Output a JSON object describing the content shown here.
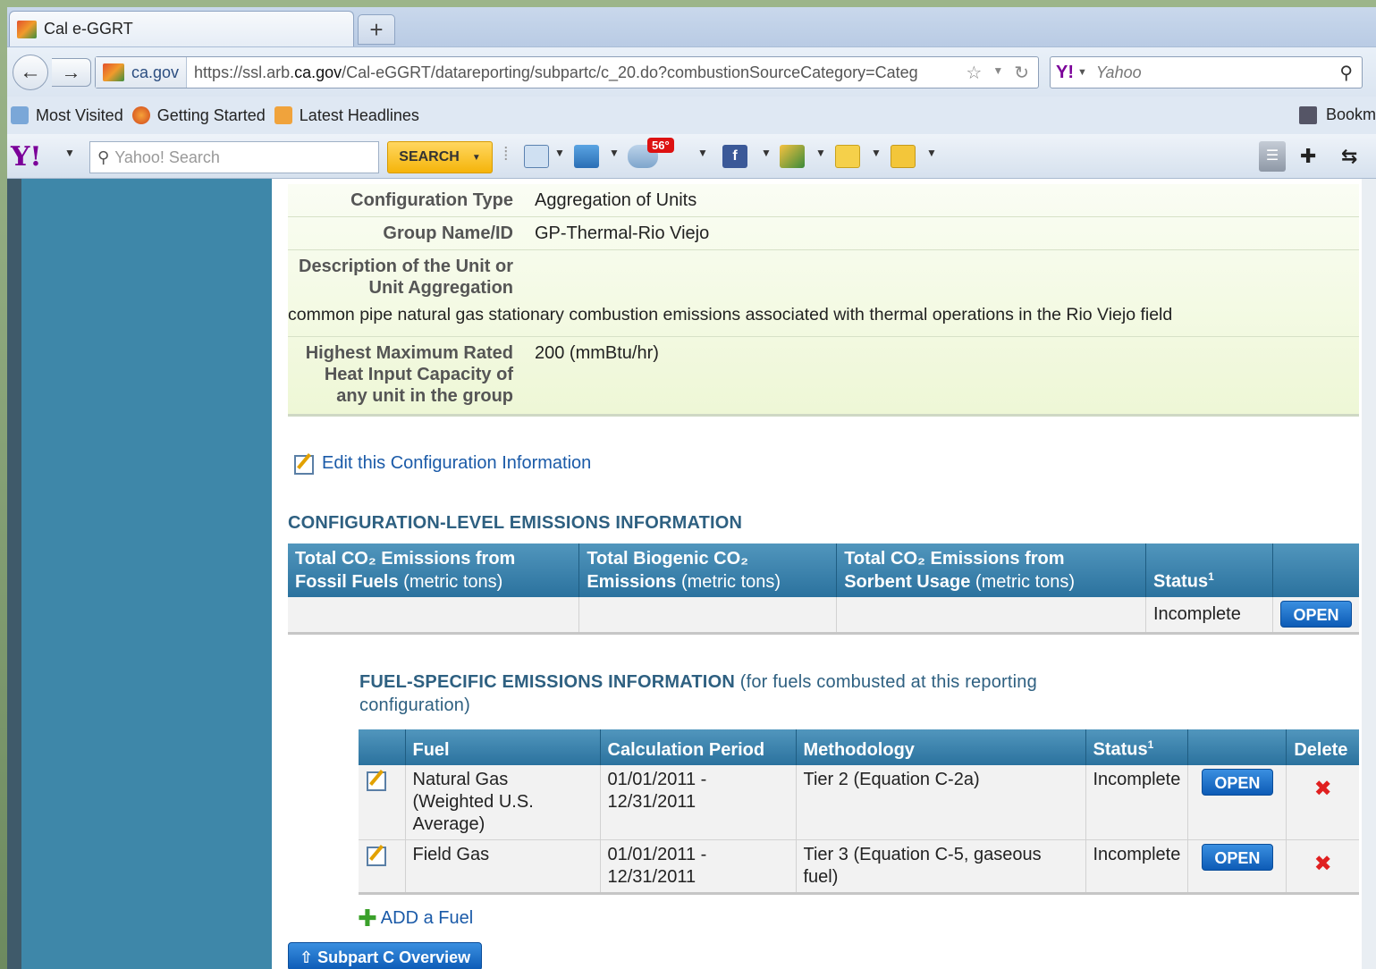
{
  "browser": {
    "tab_title": "Cal e-GGRT",
    "new_tab": "+",
    "site_identity": "ca.gov",
    "url_prefix": "https://ssl.arb.",
    "url_domain": "ca.gov",
    "url_path": "/Cal-eGGRT/datareporting/subpartc/c_20.do?combustionSourceCategory=Categ",
    "search_placeholder": "Yahoo",
    "bookmarks": [
      "Most Visited",
      "Getting Started",
      "Latest Headlines"
    ],
    "bookmarks_right": "Bookm"
  },
  "yahoo_toolbar": {
    "search_placeholder": "Yahoo! Search",
    "search_button": "SEARCH",
    "weather_badge": "56°"
  },
  "config": {
    "rows": [
      {
        "label": "Configuration Type",
        "value": "Aggregation of Units"
      },
      {
        "label": "Group Name/ID",
        "value": "GP-Thermal-Rio Viejo"
      }
    ],
    "description_label_1": "Description of the Unit or",
    "description_label_2": "Unit Aggregation",
    "description_text": "common pipe natural gas stationary combustion emissions associated with thermal operations in the Rio Viejo field",
    "capacity_label_1": "Highest Maximum Rated",
    "capacity_label_2": "Heat Input Capacity of",
    "capacity_label_3": "any unit in the group",
    "capacity_value": "200 (mmBtu/hr)",
    "edit_link": "Edit this Configuration Information"
  },
  "config_emissions": {
    "title": "CONFIGURATION-LEVEL EMISSIONS INFORMATION",
    "headers": {
      "fossil_1": "Total CO₂ Emissions from",
      "fossil_2": "Fossil Fuels",
      "fossil_unit": "(metric tons)",
      "biogenic_1": "Total Biogenic CO₂",
      "biogenic_2": "Emissions",
      "biogenic_unit": "(metric tons)",
      "sorbent_1": "Total CO₂ Emissions from",
      "sorbent_2": "Sorbent Usage",
      "sorbent_unit": "(metric tons)",
      "status": "Status",
      "status_sup": "1"
    },
    "row": {
      "fossil": "",
      "biogenic": "",
      "sorbent": "",
      "status": "Incomplete",
      "action": "OPEN"
    }
  },
  "fuel_emissions": {
    "title": "FUEL-SPECIFIC EMISSIONS INFORMATION",
    "subtitle": "(for fuels combusted at this reporting",
    "subtitle_2": "configuration)",
    "headers": {
      "fuel": "Fuel",
      "period": "Calculation Period",
      "methodology": "Methodology",
      "status": "Status",
      "status_sup": "1",
      "delete": "Delete"
    },
    "rows": [
      {
        "fuel": "Natural Gas (Weighted U.S. Average)",
        "period": "01/01/2011 - 12/31/2011",
        "methodology": "Tier 2 (Equation C-2a)",
        "status": "Incomplete",
        "action": "OPEN",
        "delete": "✖"
      },
      {
        "fuel": "Field Gas",
        "period": "01/01/2011 - 12/31/2011",
        "methodology": "Tier 3 (Equation C-5, gaseous fuel)",
        "status": "Incomplete",
        "action": "OPEN",
        "delete": "✖"
      }
    ],
    "add_fuel": "ADD a Fuel"
  },
  "footer": {
    "overview_button": "Subpart C Overview"
  }
}
